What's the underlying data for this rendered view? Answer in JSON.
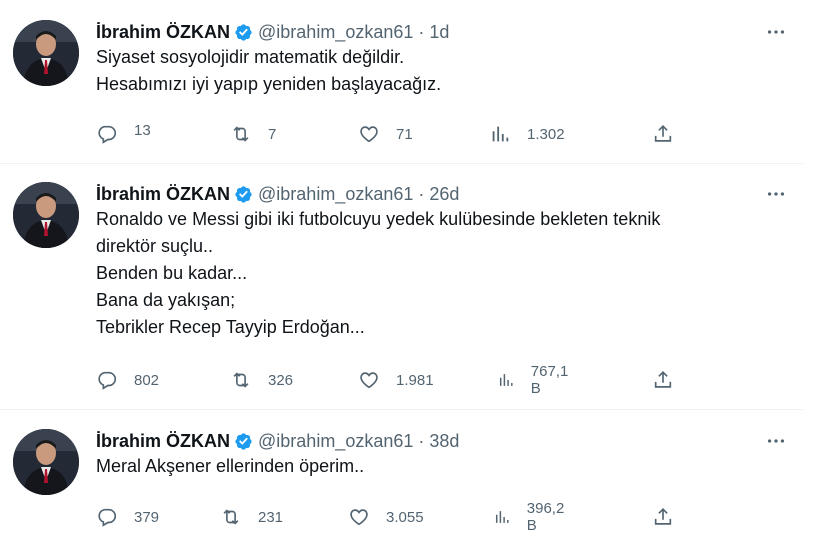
{
  "colors": {
    "text": "#0f1419",
    "muted": "#536471",
    "verified": "#1d9bf0",
    "divider": "#eff3f4"
  },
  "icons": {
    "reply": "reply-icon",
    "retweet": "retweet-icon",
    "like": "like-icon",
    "views": "views-icon",
    "share": "share-icon",
    "more": "more-icon",
    "verified": "verified-badge-icon"
  },
  "tweets": [
    {
      "author": {
        "name": "İbrahim ÖZKAN",
        "handle": "@ibrahim_ozkan61"
      },
      "separator": "·",
      "time": "1d",
      "lines": [
        "Siyaset sosyolojidir matematik değildir.",
        "Hesabımızı iyi yapıp yeniden başlayacağız."
      ],
      "stats": {
        "replies": "13",
        "retweets": "7",
        "likes": "71",
        "views": "1.302"
      }
    },
    {
      "author": {
        "name": "İbrahim ÖZKAN",
        "handle": "@ibrahim_ozkan61"
      },
      "separator": "·",
      "time": "26d",
      "lines": [
        "Ronaldo ve Messi gibi iki futbolcuyu yedek kulübesinde bekleten teknik",
        "direktör suçlu..",
        "Benden bu kadar...",
        "Bana da yakışan;",
        "Tebrikler Recep Tayyip Erdoğan..."
      ],
      "stats": {
        "replies": "802",
        "retweets": "326",
        "likes": "1.981",
        "views": "767,1 B"
      }
    },
    {
      "author": {
        "name": "İbrahim ÖZKAN",
        "handle": "@ibrahim_ozkan61"
      },
      "separator": "·",
      "time": "38d",
      "lines": [
        "Meral Akşener ellerinden öperim.."
      ],
      "stats": {
        "replies": "379",
        "retweets": "231",
        "likes": "3.055",
        "views": "396,2 B"
      }
    }
  ]
}
